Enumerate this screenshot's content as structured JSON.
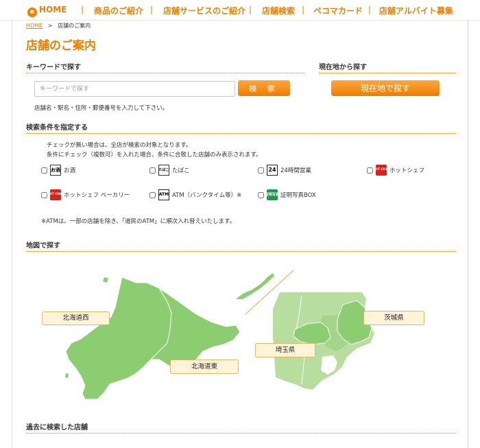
{
  "nav": {
    "home": "HOME",
    "items": [
      "商品のご紹介",
      "店舗サービスのご紹介",
      "店舗検索",
      "ペコマカード",
      "店舗アルバイト募集"
    ],
    "separator": "|"
  },
  "breadcrumb": {
    "home": "HOME",
    "sep": ">",
    "current": "店舗のご案内"
  },
  "page_title": "店舗のご案内",
  "keyword": {
    "heading": "キーワードで探す",
    "placeholder": "キーワードで探す",
    "button": "検 索",
    "help": "店舗名・駅名・住所・郵便番号を入力して下さい。"
  },
  "location": {
    "heading": "現在地から探す",
    "button": "現在地で探す"
  },
  "conditions": {
    "heading": "検索条件を指定する",
    "note1": "チェックが無い場合は、全店が検索の対象となります。",
    "note2": "条件にチェック（複数可）を入れた場合、条件に合致した店舗のみ表示されます。",
    "options": [
      {
        "label": "お酒",
        "icon": "お酒"
      },
      {
        "label": "たばこ",
        "icon": "たばこ"
      },
      {
        "label": "24時間営業",
        "icon": "24"
      },
      {
        "label": "ホットシェフ",
        "icon": "HOT CHEF"
      },
      {
        "label": "ホットシェフ ベーカリー",
        "icon": "HOT CHEF"
      },
      {
        "label": "ATM（バンクタイム等）※",
        "icon": "ATM"
      },
      {
        "label": "証明写真BOX",
        "icon": "証明写真"
      }
    ],
    "atm_note": "※ATMは、一部の店舗を除き、「道民のATM」に順次入れ替えいたします。"
  },
  "map": {
    "heading": "地図で探す",
    "regions": [
      "北海道西",
      "北海道東",
      "茨城県",
      "埼玉県"
    ]
  },
  "history": {
    "heading": "過去に検索した店舗"
  },
  "colors": {
    "accent": "#ee7d00",
    "map_green": "#8ccd72",
    "map_light": "#b7dd9f"
  }
}
